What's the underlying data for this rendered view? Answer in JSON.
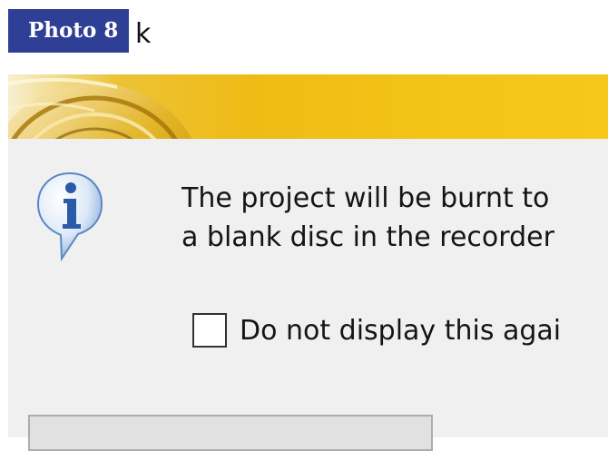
{
  "photo_label": "Photo 8",
  "window": {
    "title_visible": "k"
  },
  "dialog": {
    "icon": "info-icon",
    "message_lines": [
      "The project will be burnt to",
      "a blank disc in the recorder"
    ],
    "checkbox": {
      "label": "Do not display this agai",
      "checked": false
    }
  },
  "colors": {
    "badge_bg": "#2f3f96",
    "banner_gold": "#efbb16",
    "dialog_bg": "#f0f0f0",
    "icon_blue": "#2a5aa8"
  }
}
